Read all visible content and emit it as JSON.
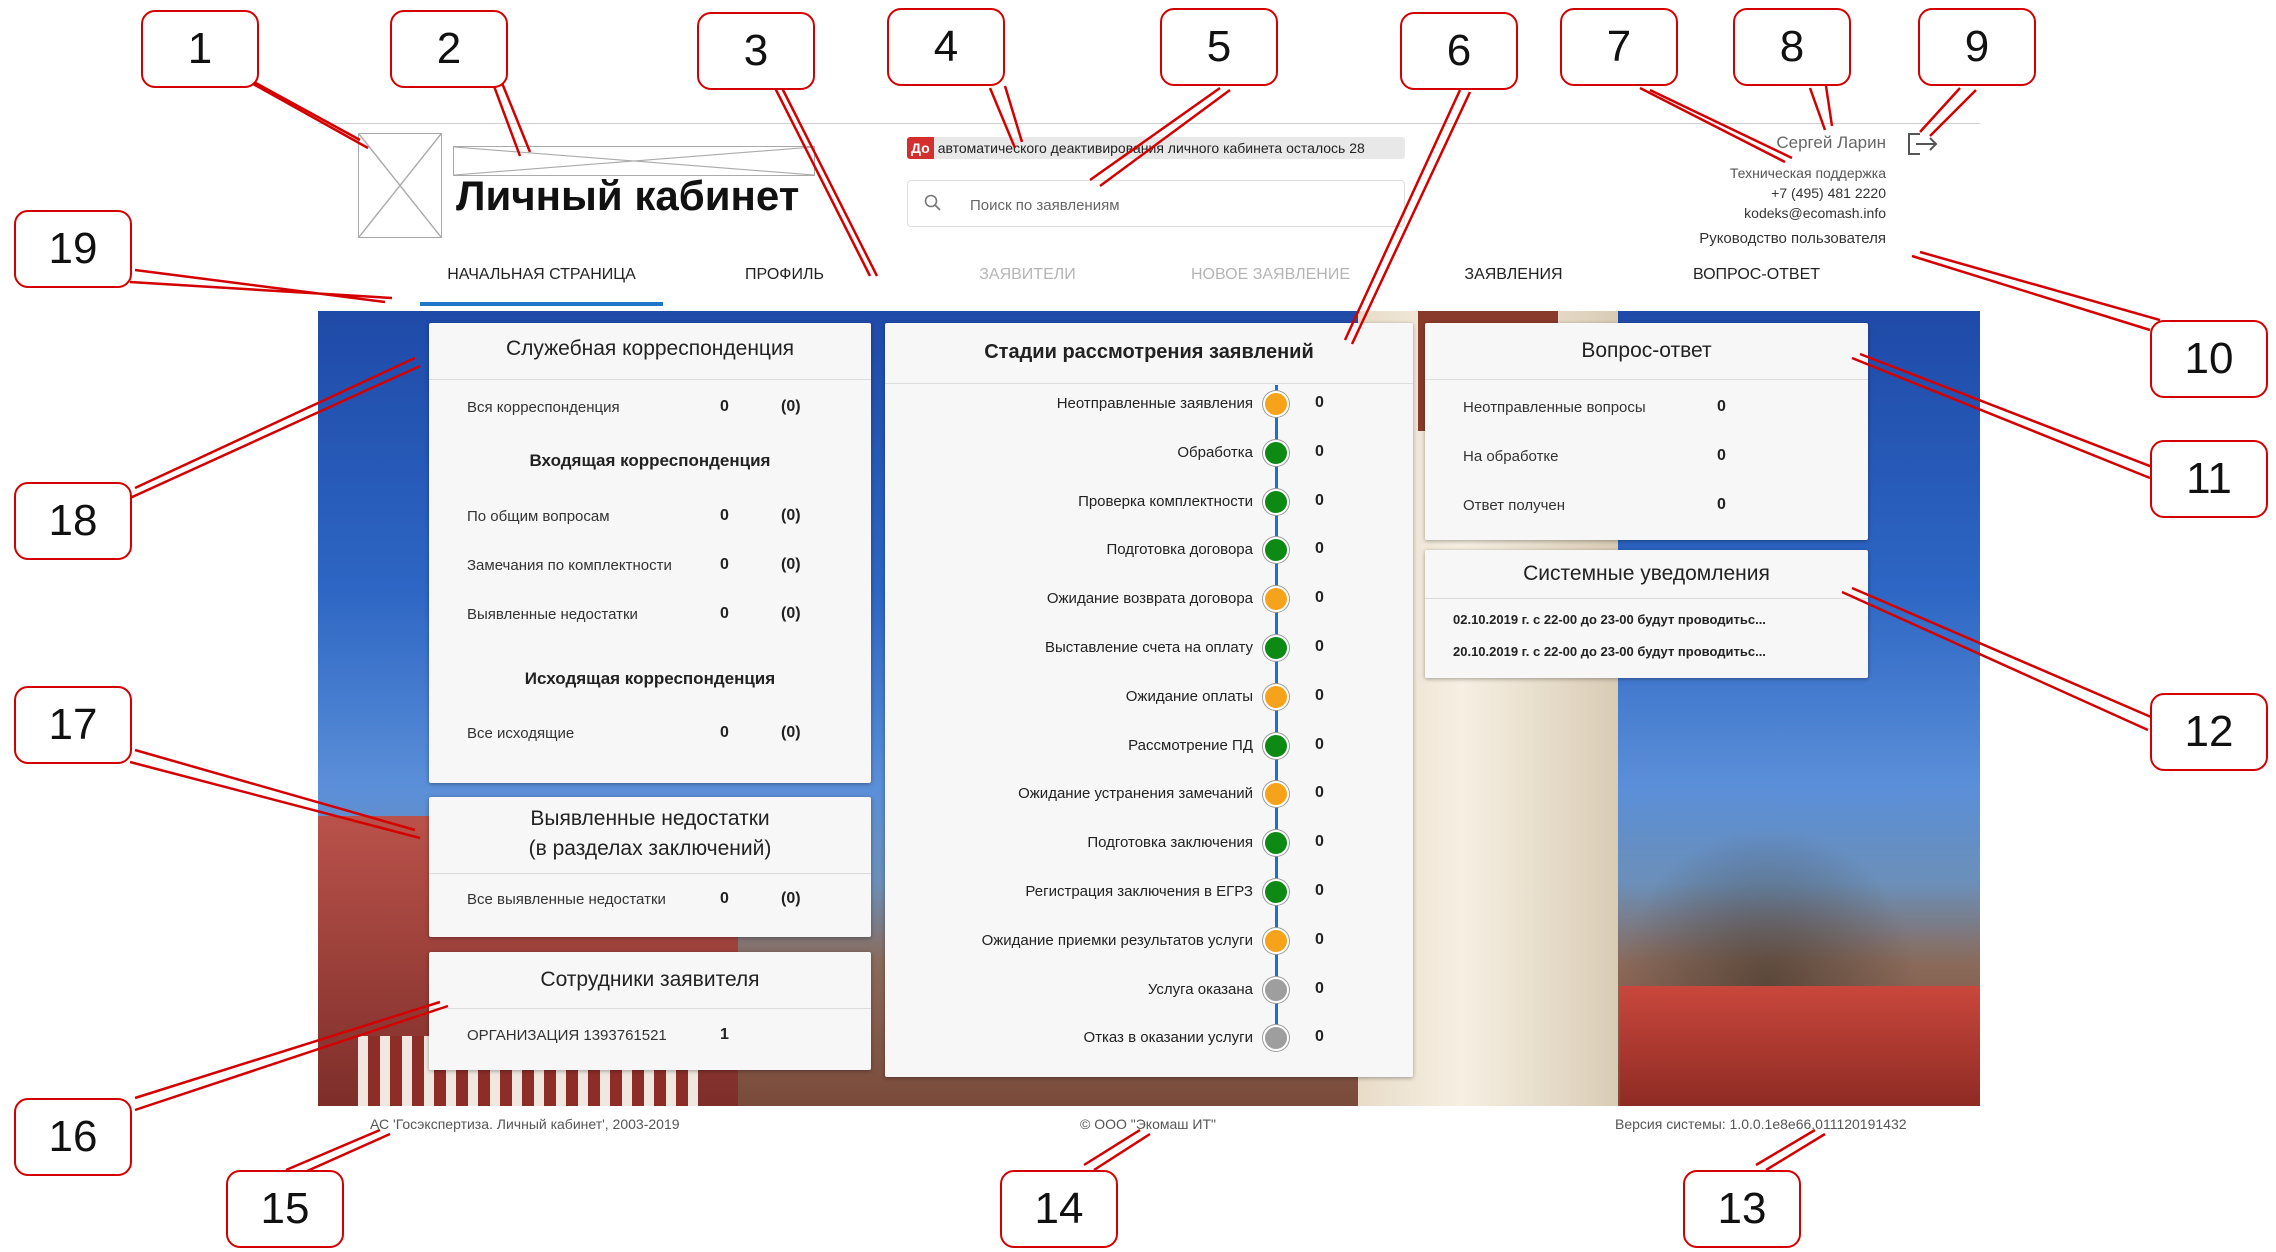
{
  "callouts": [
    "1",
    "2",
    "3",
    "4",
    "5",
    "6",
    "7",
    "8",
    "9",
    "10",
    "11",
    "12",
    "13",
    "14",
    "15",
    "16",
    "17",
    "18",
    "19"
  ],
  "header": {
    "title": "Личный кабинет",
    "notice_prefix": "До",
    "notice_text": "автоматического деактивирования личного кабинета осталось 28",
    "search_placeholder": "Поиск по заявлениям",
    "user_name": "Сергей Ларин",
    "support_title": "Техническая поддержка",
    "support_phone": "+7 (495) 481 2220",
    "support_email": "kodeks@ecomash.info",
    "manual_link": "Руководство пользователя"
  },
  "nav": {
    "tabs": [
      {
        "label": "НАЧАЛЬНАЯ СТРАНИЦА",
        "state": "active"
      },
      {
        "label": "ПРОФИЛЬ",
        "state": "normal"
      },
      {
        "label": "ЗАЯВИТЕЛИ",
        "state": "disabled"
      },
      {
        "label": "НОВОЕ ЗАЯВЛЕНИЕ",
        "state": "disabled"
      },
      {
        "label": "ЗАЯВЛЕНИЯ",
        "state": "normal"
      },
      {
        "label": "ВОПРОС-ОТВЕТ",
        "state": "normal"
      }
    ]
  },
  "correspondence": {
    "title": "Служебная корреспонденция",
    "all_label": "Вся корреспонденция",
    "all_value": "0",
    "all_paren": "(0)",
    "incoming_title": "Входящая корреспонденция",
    "incoming": [
      {
        "label": "По общим вопросам",
        "value": "0",
        "paren": "(0)"
      },
      {
        "label": "Замечания по комплектности",
        "value": "0",
        "paren": "(0)"
      },
      {
        "label": "Выявленные недостатки",
        "value": "0",
        "paren": "(0)"
      }
    ],
    "outgoing_title": "Исходящая корреспонденция",
    "outgoing_label": "Все исходящие",
    "outgoing_value": "0",
    "outgoing_paren": "(0)"
  },
  "defects": {
    "title_line1": "Выявленные недостатки",
    "title_line2": "(в разделах заключений)",
    "label": "Все выявленные недостатки",
    "value": "0",
    "paren": "(0)"
  },
  "employees": {
    "title": "Сотрудники заявителя",
    "label": "ОРГАНИЗАЦИЯ 1393761521",
    "value": "1"
  },
  "stages": {
    "title": "Стадии рассмотрения заявлений",
    "colors": {
      "orange": "#f7a21b",
      "green": "#0d8a14",
      "grey": "#9e9e9e"
    },
    "items": [
      {
        "label": "Неотправленные заявления",
        "value": "0",
        "status": "orange"
      },
      {
        "label": "Обработка",
        "value": "0",
        "status": "green"
      },
      {
        "label": "Проверка комплектности",
        "value": "0",
        "status": "green"
      },
      {
        "label": "Подготовка договора",
        "value": "0",
        "status": "green"
      },
      {
        "label": "Ожидание возврата договора",
        "value": "0",
        "status": "orange"
      },
      {
        "label": "Выставление счета на оплату",
        "value": "0",
        "status": "green"
      },
      {
        "label": "Ожидание оплаты",
        "value": "0",
        "status": "orange"
      },
      {
        "label": "Рассмотрение ПД",
        "value": "0",
        "status": "green"
      },
      {
        "label": "Ожидание устранения замечаний",
        "value": "0",
        "status": "orange"
      },
      {
        "label": "Подготовка заключения",
        "value": "0",
        "status": "green"
      },
      {
        "label": "Регистрация заключения в ЕГРЗ",
        "value": "0",
        "status": "green"
      },
      {
        "label": "Ожидание приемки результатов услуги",
        "value": "0",
        "status": "orange"
      },
      {
        "label": "Услуга оказана",
        "value": "0",
        "status": "grey"
      },
      {
        "label": "Отказ в оказании услуги",
        "value": "0",
        "status": "grey"
      }
    ]
  },
  "qa": {
    "title": "Вопрос-ответ",
    "items": [
      {
        "label": "Неотправленные вопросы",
        "value": "0"
      },
      {
        "label": "На обработке",
        "value": "0"
      },
      {
        "label": "Ответ получен",
        "value": "0"
      }
    ]
  },
  "notifications": {
    "title": "Системные уведомления",
    "items": [
      "02.10.2019 г. с 22-00 до 23-00 будут проводитьс...",
      "20.10.2019 г. с 22-00 до 23-00 будут проводитьс..."
    ]
  },
  "footer": {
    "left": "АС 'Госэкспертиза. Личный кабинет', 2003-2019",
    "center": "© ООО \"Экомаш ИТ\"",
    "right": "Версия системы: 1.0.0.1e8e66.011120191432"
  }
}
